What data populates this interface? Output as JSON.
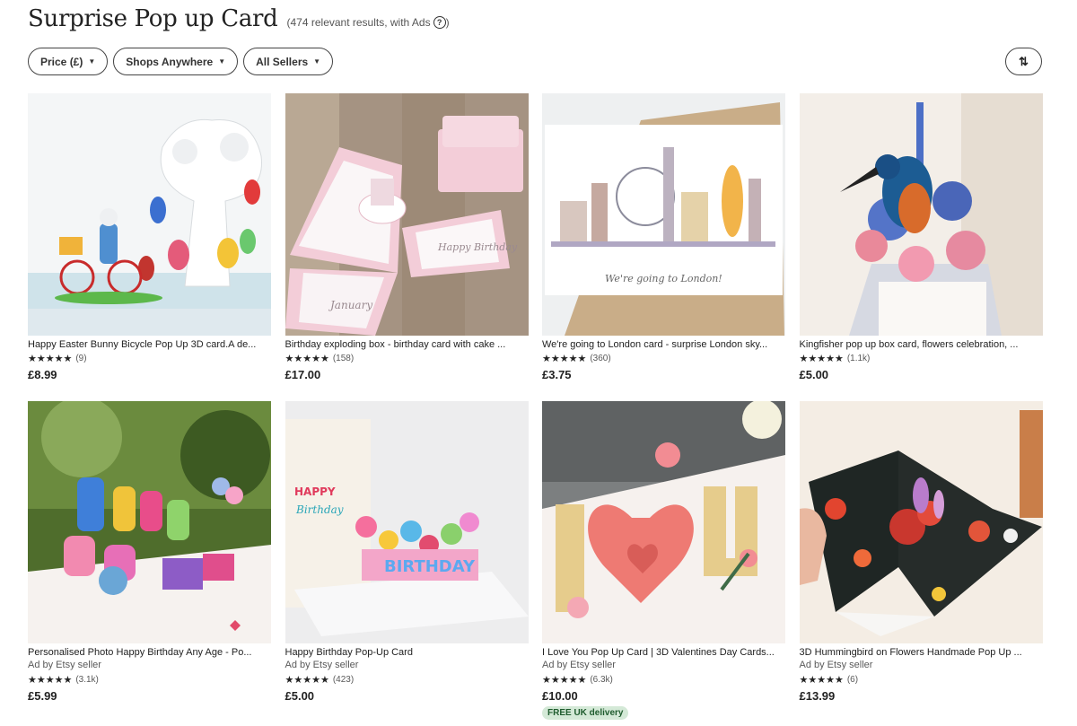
{
  "header": {
    "title": "Surprise Pop up Card",
    "results": "(474 relevant results, with Ads",
    "results_close": ")"
  },
  "filters": [
    {
      "label": "Price (£)"
    },
    {
      "label": "Shops Anywhere"
    },
    {
      "label": "All Sellers"
    }
  ],
  "sort_icon": "sort-icon",
  "products": [
    {
      "title": "Happy Easter Bunny Bicycle Pop Up 3D card.A de...",
      "ad": "",
      "stars": "★★★★★",
      "count": "(9)",
      "price": "£8.99",
      "badge": ""
    },
    {
      "title": "Birthday exploding box - birthday card with cake ...",
      "ad": "",
      "stars": "★★★★★",
      "count": "(158)",
      "price": "£17.00",
      "badge": ""
    },
    {
      "title": "We're going to London card - surprise London sky...",
      "ad": "",
      "stars": "★★★★★",
      "count": "(360)",
      "price": "£3.75",
      "badge": ""
    },
    {
      "title": "Kingfisher pop up box card, flowers celebration, ...",
      "ad": "",
      "stars": "★★★★★",
      "count": "(1.1k)",
      "price": "£5.00",
      "badge": ""
    },
    {
      "title": "Personalised Photo Happy Birthday Any Age - Po...",
      "ad": "Ad by Etsy seller",
      "stars": "★★★★★",
      "count": "(3.1k)",
      "price": "£5.99",
      "badge": ""
    },
    {
      "title": "Happy Birthday Pop-Up Card",
      "ad": "Ad by Etsy seller",
      "stars": "★★★★★",
      "count": "(423)",
      "price": "£5.00",
      "badge": ""
    },
    {
      "title": "I Love You Pop Up Card | 3D Valentines Day Cards...",
      "ad": "Ad by Etsy seller",
      "stars": "★★★★★",
      "count": "(6.3k)",
      "price": "£10.00",
      "badge": "FREE UK delivery"
    },
    {
      "title": "3D Hummingbird on Flowers Handmade Pop Up ...",
      "ad": "Ad by Etsy seller",
      "stars": "★★★★★",
      "count": "(6)",
      "price": "£13.99",
      "badge": ""
    }
  ]
}
